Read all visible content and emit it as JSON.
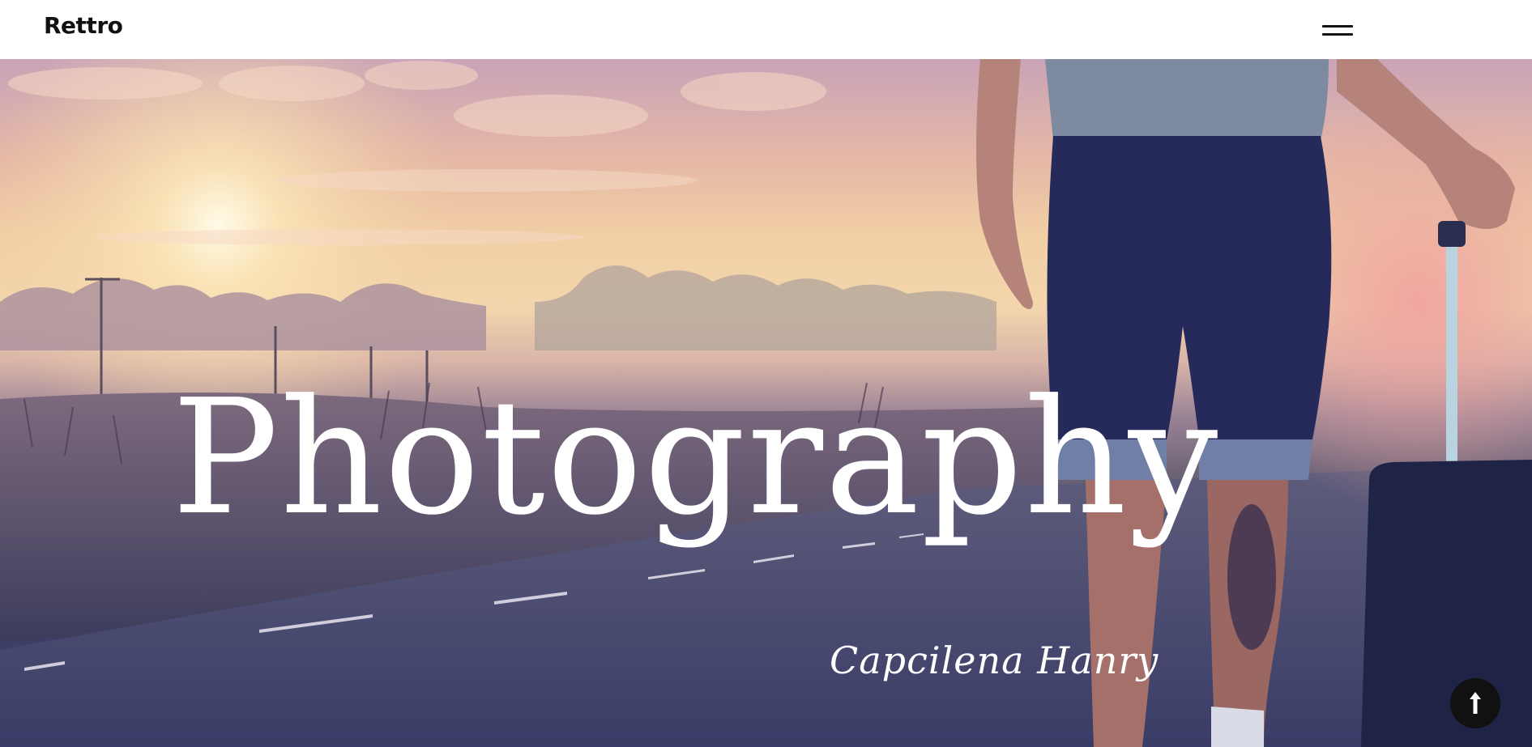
{
  "header": {
    "logo_text": "Rettro",
    "menu_icon": "hamburger-menu-icon"
  },
  "hero": {
    "title": "Photography",
    "signature": "Capcilena Hanry",
    "background_icon": "traveler-on-road-photo"
  },
  "scroll_top": {
    "icon": "arrow-up-icon"
  },
  "colors": {
    "header_bg": "#ffffff",
    "logo": "#111111",
    "title": "#ffffff",
    "scroll_button": "#111111"
  }
}
